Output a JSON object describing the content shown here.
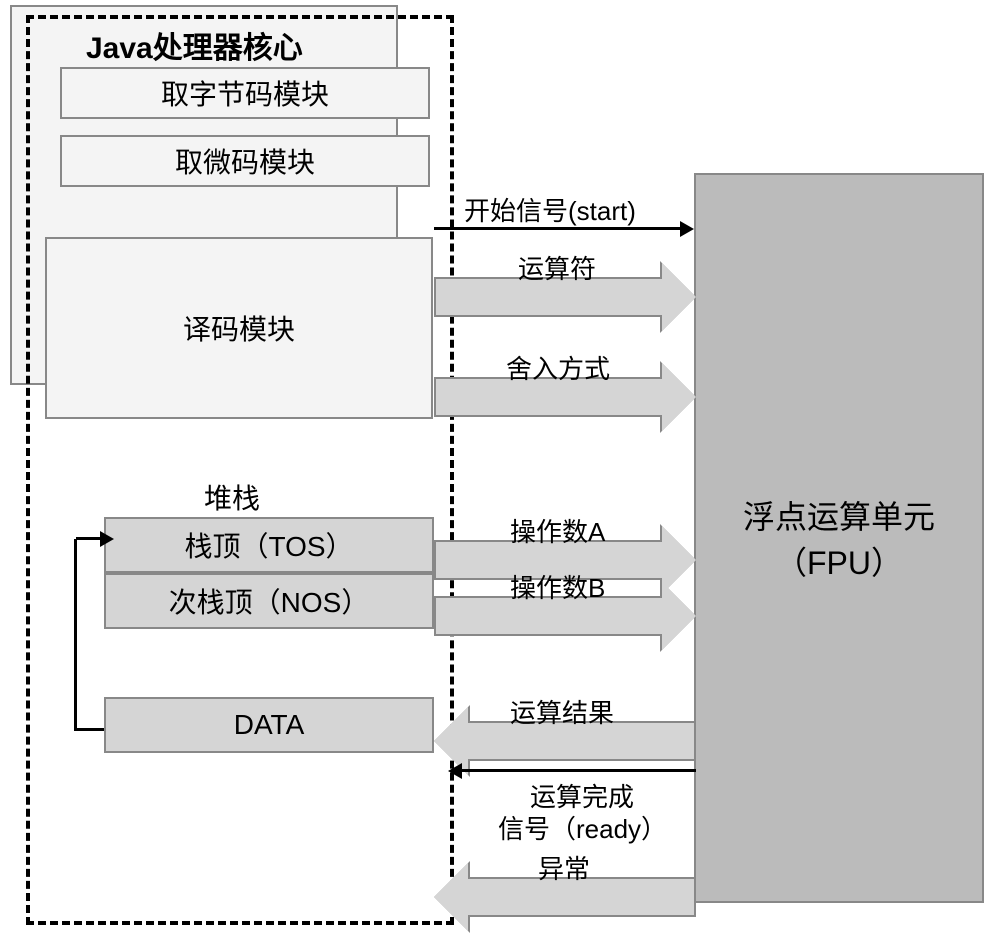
{
  "java_core": {
    "title": "Java处理器核心",
    "bytecode_module": "取字节码模块",
    "microcode_module": "取微码模块",
    "decode_module": "译码模块",
    "stack": {
      "title": "堆栈",
      "tos": "栈顶（TOS）",
      "nos": "次栈顶（NOS）",
      "data": "DATA"
    }
  },
  "fpu": {
    "title_line1": "浮点运算单元",
    "title_line2": "（FPU）"
  },
  "signals": {
    "start": "开始信号(start)",
    "operator": "运算符",
    "rounding": "舍入方式",
    "operand_a": "操作数A",
    "operand_b": "操作数B",
    "result": "运算结果",
    "ready_line1": "运算完成",
    "ready_line2": "信号（ready）",
    "exception": "异常"
  }
}
